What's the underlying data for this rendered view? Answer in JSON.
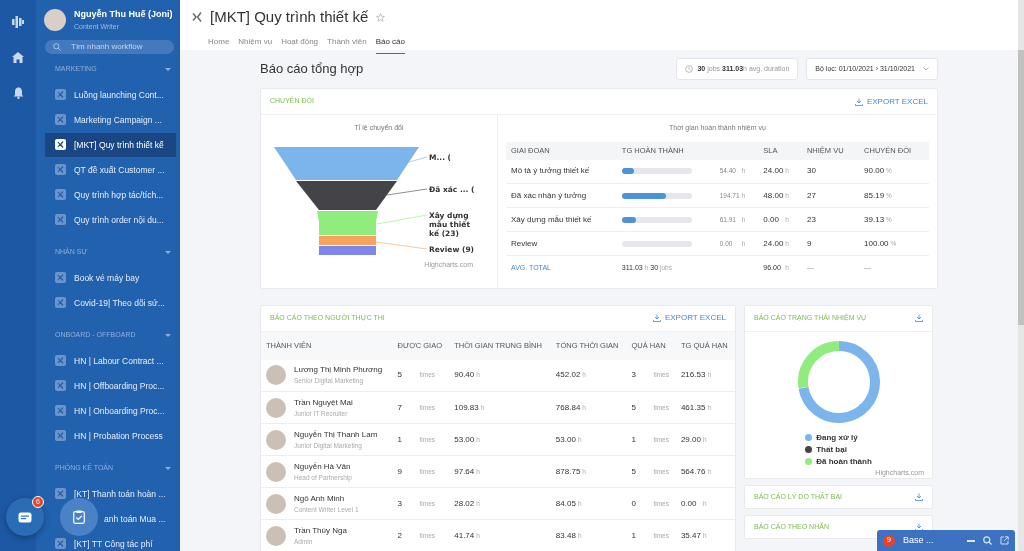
{
  "user": {
    "name": "Nguyễn Thu Huế (Joni)",
    "role": "Content Writer"
  },
  "search": {
    "placeholder": "Tìm nhanh workflow"
  },
  "sidebar": {
    "sections": [
      {
        "title": "MARKETING",
        "expanded": true,
        "items": [
          {
            "label": "Luồng launching Cont...",
            "selected": false
          },
          {
            "label": "Marketing Campaign ...",
            "selected": false
          },
          {
            "label": "[MKT] Quy trình thiết kế",
            "selected": true
          },
          {
            "label": "QT đề xuất Customer ...",
            "selected": false
          },
          {
            "label": "Quy trình hợp tác/tích...",
            "selected": false
          },
          {
            "label": "Quy trình order nội du...",
            "selected": false
          }
        ]
      },
      {
        "title": "NHÂN SỰ",
        "expanded": true,
        "items": [
          {
            "label": "Book vé máy bay",
            "selected": false
          },
          {
            "label": "Covid-19| Theo dõi sứ...",
            "selected": false
          }
        ]
      },
      {
        "title": "ONBOARD - OFFBOARD",
        "expanded": true,
        "items": [
          {
            "label": "HN | Labour Contract ...",
            "selected": false
          },
          {
            "label": "HN | Offboarding Proc...",
            "selected": false
          },
          {
            "label": "HN | Onboarding Proc...",
            "selected": false
          },
          {
            "label": "HN | Probation Process",
            "selected": false
          }
        ]
      },
      {
        "title": "PHÒNG KẾ TOÁN",
        "expanded": true,
        "items": [
          {
            "label": "[KT] Thanh toán hoàn ...",
            "selected": false
          },
          {
            "label": "anh toán Mua ...",
            "selected": false,
            "kind": "covered"
          },
          {
            "label": "[KT] TT Công tác phí",
            "selected": false
          }
        ]
      }
    ]
  },
  "floating": {
    "chat_badge": "6"
  },
  "header": {
    "title": "[MKT] Quy trình thiết kế",
    "tabs": [
      {
        "label": "Home",
        "selected": false
      },
      {
        "label": "Nhiệm vụ",
        "selected": false
      },
      {
        "label": "Hoạt động",
        "selected": false
      },
      {
        "label": "Thành viên",
        "selected": false
      },
      {
        "label": "Báo cáo",
        "selected": true
      }
    ]
  },
  "report": {
    "title": "Báo cáo tổng hợp",
    "jobs": "30",
    "jobs_unit": "jobs",
    "duration": "311.03",
    "duration_unit": "h avg. duration",
    "filter": "Bộ lọc: 01/10/2021 › 31/10/2021"
  },
  "conversion": {
    "title": "CHUYỂN ĐỔI",
    "export": "EXPORT EXCEL",
    "funnel": {
      "title": "Tỉ lệ chuyển đổi",
      "credit": "Highcharts.com",
      "stages": [
        {
          "label": "M... (",
          "color": "#7cb5ec"
        },
        {
          "label": "Đã xác ... (",
          "color": "#434348"
        },
        {
          "label": "Xây dựng mẫu thiết kế (23)",
          "color": "#90ed7d"
        },
        {
          "label": "Review (9)",
          "color": "#f7a35c"
        },
        {
          "color": "#8085e9"
        }
      ]
    },
    "stage_table": {
      "title": "Thời gian hoàn thành nhiệm vụ",
      "columns": [
        "GIAI ĐOẠN",
        "TG HOÀN THÀNH",
        "SLA",
        "NHIỆM VỤ",
        "CHUYỂN ĐỔI"
      ],
      "rows": [
        {
          "stage": "Mô tả ý tưởng thiết kế",
          "level": 0.17,
          "time": "54.40",
          "time_unit": "h",
          "sla": "24.00",
          "sla_unit": "h",
          "tasks": "30",
          "conversion": "90.00",
          "conversion_unit": "%"
        },
        {
          "stage": "Đã xác nhận ý tưởng",
          "level": 0.63,
          "time": "194.71",
          "time_unit": "h",
          "sla": "48.00",
          "sla_unit": "h",
          "tasks": "27",
          "conversion": "85.19",
          "conversion_unit": "%"
        },
        {
          "stage": "Xây dựng mẫu thiết kế",
          "level": 0.2,
          "time": "61.91",
          "time_unit": "h",
          "sla": "0.00",
          "sla_unit": "h",
          "tasks": "23",
          "conversion": "39.13",
          "conversion_unit": "%"
        },
        {
          "stage": "Review",
          "time": "0.00",
          "time_unit": "h",
          "sla": "24.00",
          "sla_unit": "h",
          "tasks": "9",
          "conversion": "100.00",
          "conversion_unit": "%"
        }
      ],
      "total": {
        "label": "AVG. TOTAL",
        "time": "311.03",
        "time_unit": "h",
        "jobs": "30",
        "jobs_unit": "jobs",
        "sla": "96.00",
        "sla_unit": "h",
        "tasks": "—",
        "conversion": "—"
      }
    }
  },
  "members": {
    "title": "BÁO CÁO THEO NGƯỜI THỰC THI",
    "export": "EXPORT EXCEL",
    "columns": [
      "THÀNH VIÊN",
      "ĐƯỢC GIAO",
      "THỜI GIAN TRUNG BÌNH",
      "TỔNG THỜI GIAN",
      "QUÁ HẠN",
      "TG QUÁ HẠN"
    ],
    "rows": [
      {
        "name": "Lương Thị Minh Phương",
        "role": "Senior Digital Marketing",
        "assigned": "5",
        "assigned_unit": "times",
        "avg": "90.40",
        "avg_unit": "h",
        "total": "452.02",
        "total_unit": "h",
        "overdue": "3",
        "overdue_unit": "times",
        "overdue_time": "216.53",
        "overdue_time_unit": "h"
      },
      {
        "name": "Trần Nguyệt Mai",
        "role": "Junior IT Recruiter",
        "assigned": "7",
        "assigned_unit": "times",
        "avg": "109.83",
        "avg_unit": "h",
        "total": "768.84",
        "total_unit": "h",
        "overdue": "5",
        "overdue_unit": "times",
        "overdue_time": "461.35",
        "overdue_time_unit": "h"
      },
      {
        "name": "Nguyễn Thị Thanh Lam",
        "role": "Junior Digital Marketing",
        "assigned": "1",
        "assigned_unit": "times",
        "avg": "53.00",
        "avg_unit": "h",
        "total": "53.00",
        "total_unit": "h",
        "overdue": "1",
        "overdue_unit": "times",
        "overdue_time": "29.00",
        "overdue_time_unit": "h"
      },
      {
        "name": "Nguyễn Hà Vân",
        "role": "Head of Partnership",
        "assigned": "9",
        "assigned_unit": "times",
        "avg": "97.64",
        "avg_unit": "h",
        "total": "878.75",
        "total_unit": "h",
        "overdue": "5",
        "overdue_unit": "times",
        "overdue_time": "564.76",
        "overdue_time_unit": "h"
      },
      {
        "name": "Ngô Anh Minh",
        "role": "Content Writer Level 1",
        "assigned": "3",
        "assigned_unit": "times",
        "avg": "28.02",
        "avg_unit": "h",
        "total": "84.05",
        "total_unit": "h",
        "overdue": "0",
        "overdue_unit": "times",
        "overdue_time": "0.00",
        "overdue_time_unit": "h"
      },
      {
        "name": "Trần Thúy Nga",
        "role": "Admin",
        "assigned": "2",
        "assigned_unit": "times",
        "avg": "41.74",
        "avg_unit": "h",
        "total": "83.48",
        "total_unit": "h",
        "overdue": "1",
        "overdue_unit": "times",
        "overdue_time": "35.47",
        "overdue_time_unit": "h"
      }
    ]
  },
  "status_report": {
    "title": "BÁO CÁO TRẠNG THÁI NHIỆM VỤ",
    "credit": "Highcharts.com",
    "legend": [
      {
        "label": "Đang xử lý",
        "color": "#7cb5ec"
      },
      {
        "label": "Thất bại",
        "color": "#434348"
      },
      {
        "label": "Đã hoàn thành",
        "color": "#90ed7d"
      }
    ]
  },
  "other_reports": [
    {
      "title": "BÁO CÁO LÝ DO THẤT BẠI"
    },
    {
      "title": "BÁO CÁO THEO NHÃN"
    }
  ],
  "chat_bar": {
    "badge": "9",
    "title": "Base ..."
  }
}
